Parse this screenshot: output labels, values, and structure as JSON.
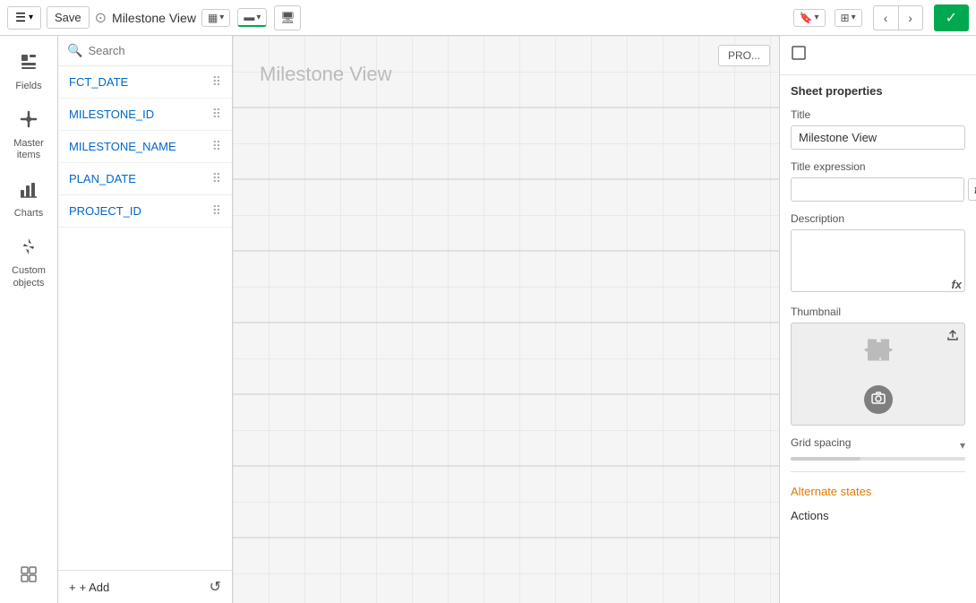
{
  "toolbar": {
    "hamburger_label": "☰",
    "save_label": "Save",
    "title": "Milestone View",
    "title_icon": "●",
    "view_toggle1": "⬜",
    "view_toggle2": "⬛",
    "view_toggle3": "🖥",
    "bookmark_btn": "🔖",
    "layout_btn": "⊞",
    "prev_btn": "‹",
    "next_btn": "›",
    "check_btn": "✓"
  },
  "left_sidebar": {
    "items": [
      {
        "id": "fields",
        "label": "Fields",
        "icon": "🗄"
      },
      {
        "id": "master-items",
        "label": "Master items",
        "icon": "🔗"
      },
      {
        "id": "charts",
        "label": "Charts",
        "icon": "📊"
      },
      {
        "id": "custom-objects",
        "label": "Custom objects",
        "icon": "🧩"
      }
    ],
    "footer_icon": "⊞"
  },
  "fields_panel": {
    "search_placeholder": "Search",
    "fields": [
      {
        "name": "FCT_DATE"
      },
      {
        "name": "MILESTONE_ID"
      },
      {
        "name": "MILESTONE_NAME"
      },
      {
        "name": "PLAN_DATE"
      },
      {
        "name": "PROJECT_ID"
      }
    ],
    "add_label": "+ Add",
    "refresh_icon": "↺"
  },
  "canvas": {
    "title": "Milestone View",
    "pro_btn_label": "PRO..."
  },
  "right_panel": {
    "sheet_icon": "⬜",
    "section_title": "Sheet properties",
    "title_label": "Title",
    "title_value": "Milestone View",
    "title_expression_label": "Title expression",
    "title_expression_value": "",
    "description_label": "Description",
    "description_value": "",
    "thumbnail_label": "Thumbnail",
    "thumbnail_puzzle_icon": "🧩",
    "thumbnail_camera_icon": "📷",
    "grid_spacing_label": "Grid spacing",
    "alternate_states_label": "Alternate states",
    "actions_label": "Actions",
    "fx_label": "fx",
    "upload_icon": "⬆"
  }
}
